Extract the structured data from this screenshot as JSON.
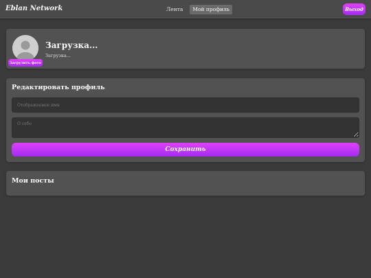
{
  "header": {
    "brand": "Eblan Network",
    "nav": [
      {
        "label": "Лента",
        "active": false
      },
      {
        "label": "Мой профиль",
        "active": true
      }
    ],
    "logout_label": "Выход"
  },
  "profile": {
    "display_name": "Загрузка...",
    "subline": "Загрузка...",
    "upload_photo_label": "Загрузить фото"
  },
  "edit_profile": {
    "title": "Редактировать профиль",
    "display_name_placeholder": "Отображаемое имя",
    "about_placeholder": "О себе",
    "save_label": "Сохранить"
  },
  "posts": {
    "title": "Мои посты"
  },
  "colors": {
    "background": "#3b3b3b",
    "card": "#525252",
    "accent_top": "#e040fb",
    "accent_bottom": "#a22df0"
  }
}
